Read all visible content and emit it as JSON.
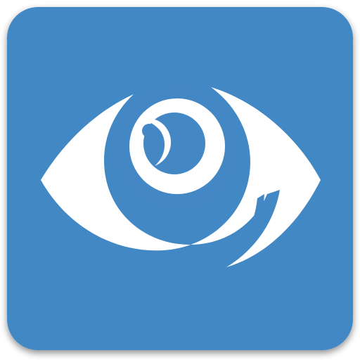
{
  "icon": {
    "name": "eye-icon",
    "colors": {
      "tile": "#4388C5",
      "tile_shadow": "#9A9A9A",
      "glyph": "#FFFFFF"
    }
  }
}
